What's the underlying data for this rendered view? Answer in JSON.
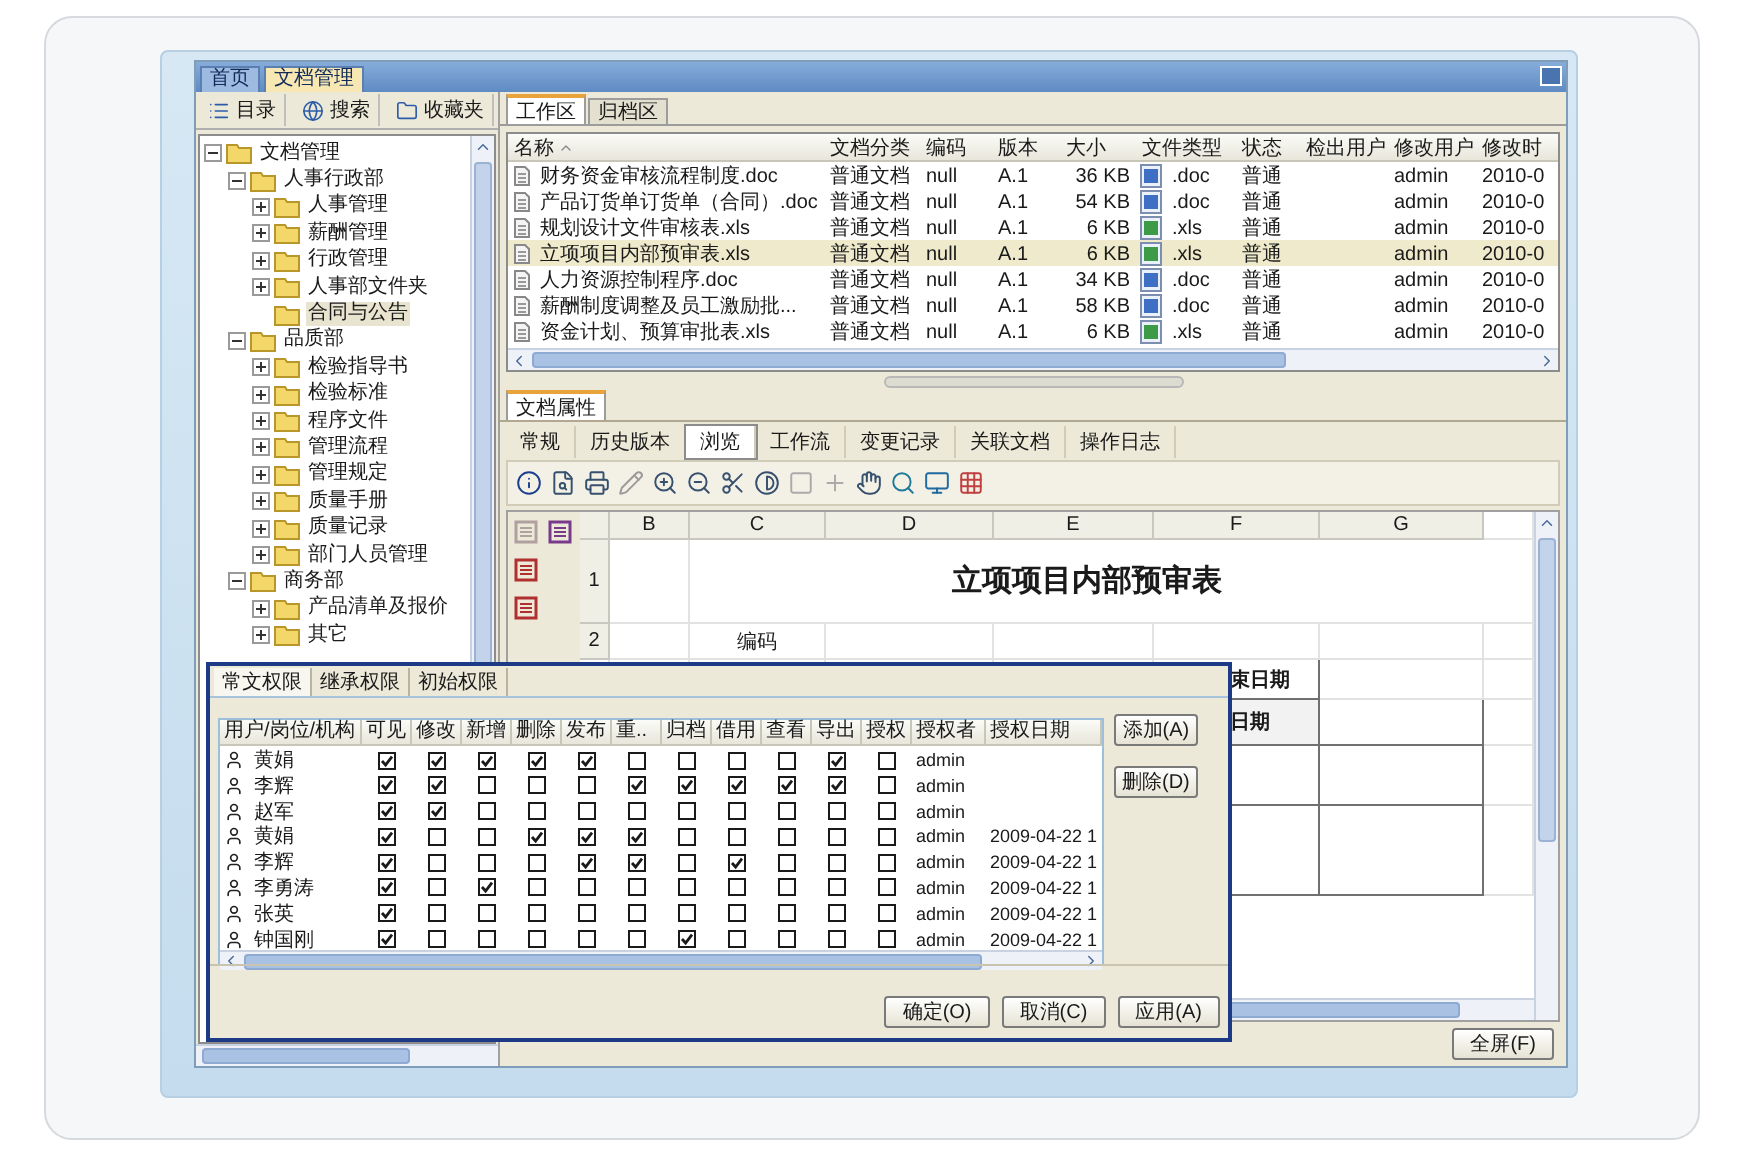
{
  "window": {
    "tabs": [
      {
        "label": "首页",
        "selected": false
      },
      {
        "label": "文档管理",
        "selected": true
      }
    ]
  },
  "sidebar": {
    "toolbar": [
      "目录",
      "搜索",
      "收藏夹"
    ],
    "tree": [
      {
        "label": "文档管理",
        "expanded": true,
        "selected": false,
        "children": [
          {
            "label": "人事行政部",
            "expanded": true,
            "selected": false,
            "children": [
              {
                "label": "人事管理",
                "expanded": false,
                "selected": false
              },
              {
                "label": "薪酬管理",
                "expanded": false,
                "selected": false
              },
              {
                "label": "行政管理",
                "expanded": false,
                "selected": false
              },
              {
                "label": "人事部文件夹",
                "expanded": false,
                "selected": false
              },
              {
                "label": "合同与公告",
                "selected": true
              }
            ]
          },
          {
            "label": "品质部",
            "expanded": true,
            "selected": false,
            "children": [
              {
                "label": "检验指导书",
                "expanded": false,
                "selected": false
              },
              {
                "label": "检验标准",
                "expanded": false,
                "selected": false
              },
              {
                "label": "程序文件",
                "expanded": false,
                "selected": false
              },
              {
                "label": "管理流程",
                "expanded": false,
                "selected": false
              },
              {
                "label": "管理规定",
                "expanded": false,
                "selected": false
              },
              {
                "label": "质量手册",
                "expanded": false,
                "selected": false
              },
              {
                "label": "质量记录",
                "expanded": false,
                "selected": false
              },
              {
                "label": "部门人员管理",
                "expanded": false,
                "selected": false
              }
            ]
          },
          {
            "label": "商务部",
            "expanded": true,
            "selected": false,
            "children": [
              {
                "label": "产品清单及报价",
                "expanded": false,
                "selected": false
              },
              {
                "label": "其它",
                "expanded": false,
                "selected": false
              }
            ]
          }
        ]
      }
    ]
  },
  "files": {
    "tabs": [
      {
        "label": "工作区",
        "selected": true
      },
      {
        "label": "归档区",
        "selected": false
      }
    ],
    "columns": [
      "名称",
      "文档分类",
      "编码",
      "版本",
      "大小",
      "文件类型",
      "状态",
      "检出用户",
      "修改用户",
      "修改时"
    ],
    "rows": [
      {
        "name": "财务资金审核流程制度.doc",
        "category": "普通文档",
        "code": "null",
        "version": "A.1",
        "size": "36 KB",
        "kind": "doc",
        "type": ".doc",
        "status": "普通",
        "modified_by": "admin",
        "modified_time": "2010-0",
        "selected": false
      },
      {
        "name": "产品订货单订货单（合同）.doc",
        "category": "普通文档",
        "code": "null",
        "version": "A.1",
        "size": "54 KB",
        "kind": "doc",
        "type": ".doc",
        "status": "普通",
        "modified_by": "admin",
        "modified_time": "2010-0",
        "selected": false
      },
      {
        "name": "规划设计文件审核表.xls",
        "category": "普通文档",
        "code": "null",
        "version": "A.1",
        "size": "6 KB",
        "kind": "xls",
        "type": ".xls",
        "status": "普通",
        "modified_by": "admin",
        "modified_time": "2010-0",
        "selected": false
      },
      {
        "name": "立项项目内部预审表.xls",
        "category": "普通文档",
        "code": "null",
        "version": "A.1",
        "size": "6 KB",
        "kind": "xls",
        "type": ".xls",
        "status": "普通",
        "modified_by": "admin",
        "modified_time": "2010-0",
        "selected": true
      },
      {
        "name": "人力资源控制程序.doc",
        "category": "普通文档",
        "code": "null",
        "version": "A.1",
        "size": "34 KB",
        "kind": "doc",
        "type": ".doc",
        "status": "普通",
        "modified_by": "admin",
        "modified_time": "2010-0",
        "selected": false
      },
      {
        "name": "薪酬制度调整及员工激励批...",
        "category": "普通文档",
        "code": "null",
        "version": "A.1",
        "size": "58 KB",
        "kind": "doc",
        "type": ".doc",
        "status": "普通",
        "modified_by": "admin",
        "modified_time": "2010-0",
        "selected": false
      },
      {
        "name": "资金计划、预算审批表.xls",
        "category": "普通文档",
        "code": "null",
        "version": "A.1",
        "size": "6 KB",
        "kind": "xls",
        "type": ".xls",
        "status": "普通",
        "modified_by": "admin",
        "modified_time": "2010-0",
        "selected": false
      }
    ]
  },
  "properties": {
    "title": "文档属性",
    "tabs": [
      {
        "label": "常规",
        "selected": false
      },
      {
        "label": "历史版本",
        "selected": false
      },
      {
        "label": "浏览",
        "selected": true
      },
      {
        "label": "工作流",
        "selected": false
      },
      {
        "label": "变更记录",
        "selected": false
      },
      {
        "label": "关联文档",
        "selected": false
      },
      {
        "label": "操作日志",
        "selected": false
      }
    ],
    "sheet": {
      "columns": [
        "B",
        "C",
        "D",
        "E",
        "F",
        "G"
      ],
      "row_numbers": [
        "1",
        "2"
      ],
      "title": "立项项目内部预审表",
      "code_label": "编码",
      "end_date_label": "束日期",
      "date_label": "日期"
    },
    "fullscreen_button": "全屏(F)"
  },
  "dialog": {
    "tabs": [
      {
        "label": "常文权限",
        "selected": true
      },
      {
        "label": "继承权限",
        "selected": false
      },
      {
        "label": "初始权限",
        "selected": false
      }
    ],
    "columns": [
      "用户/岗位/机构",
      "可见",
      "修改",
      "新增",
      "删除",
      "发布",
      "重..",
      "归档",
      "借用",
      "查看",
      "导出",
      "授权",
      "授权者",
      "授权日期"
    ],
    "rows": [
      {
        "user": "黄娟",
        "checks": [
          true,
          true,
          true,
          true,
          true,
          false,
          false,
          false,
          false,
          true,
          false
        ],
        "grantor": "admin"
      },
      {
        "user": "李辉",
        "checks": [
          true,
          true,
          false,
          false,
          false,
          true,
          true,
          true,
          true,
          true,
          false
        ],
        "grantor": "admin"
      },
      {
        "user": "赵军",
        "checks": [
          true,
          true,
          false,
          false,
          false,
          false,
          false,
          false,
          false,
          false,
          false
        ],
        "grantor": "admin"
      },
      {
        "user": "黄娟",
        "checks": [
          true,
          false,
          false,
          true,
          true,
          true,
          false,
          false,
          false,
          false,
          false
        ],
        "grantor": "admin",
        "date": "2009-04-22 1"
      },
      {
        "user": "李辉",
        "checks": [
          true,
          false,
          false,
          false,
          true,
          true,
          false,
          true,
          false,
          false,
          false
        ],
        "grantor": "admin",
        "date": "2009-04-22 1"
      },
      {
        "user": "李勇涛",
        "checks": [
          true,
          false,
          true,
          false,
          false,
          false,
          false,
          false,
          false,
          false,
          false
        ],
        "grantor": "admin",
        "date": "2009-04-22 1"
      },
      {
        "user": "张英",
        "checks": [
          true,
          false,
          false,
          false,
          false,
          false,
          false,
          false,
          false,
          false,
          false
        ],
        "grantor": "admin",
        "date": "2009-04-22 1"
      },
      {
        "user": "钟国刚",
        "checks": [
          true,
          false,
          false,
          false,
          false,
          false,
          true,
          false,
          false,
          false,
          false
        ],
        "grantor": "admin",
        "date": "2009-04-22 1"
      }
    ],
    "side_buttons": [
      "添加(A)",
      "删除(D)"
    ],
    "buttons": [
      "确定(O)",
      "取消(C)",
      "应用(A)"
    ]
  }
}
